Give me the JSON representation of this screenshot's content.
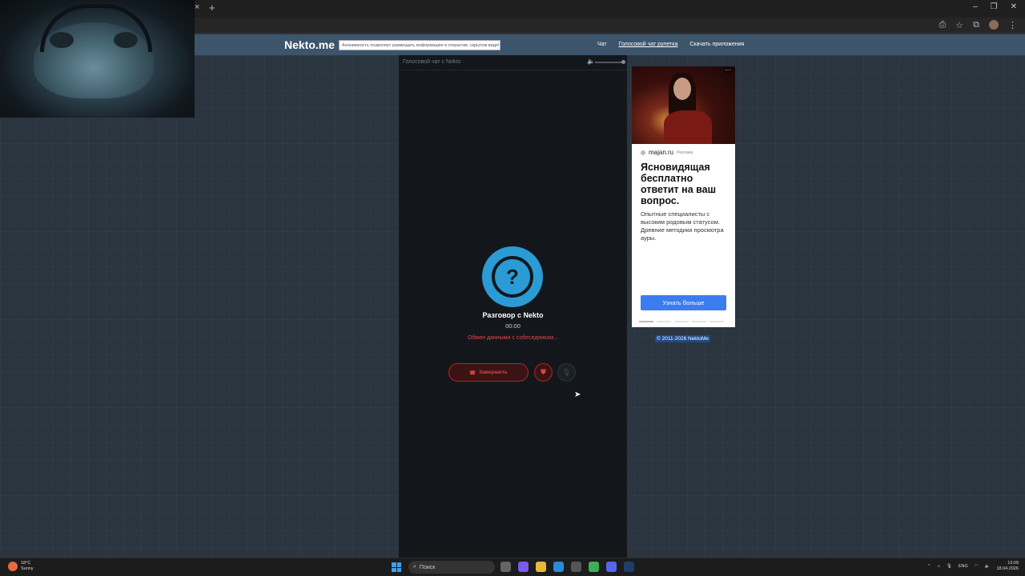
{
  "browser": {
    "tab_close": "×",
    "tab_new": "+",
    "window_controls": [
      "–",
      "❐",
      "✕"
    ],
    "toolbar_icons": [
      "install-icon",
      "star-icon",
      "extensions-icon",
      "profile-icon",
      "menu-icon"
    ]
  },
  "site": {
    "logo": "Nekto.me",
    "notice": "Анонимность позволяет размещать информацию в открытом, скрытом виде!",
    "nav": [
      {
        "label": "Чат",
        "active": false
      },
      {
        "label": "Голосовой чат рулетка",
        "active": true
      },
      {
        "label": "Скачать приложения",
        "active": false
      }
    ]
  },
  "chat": {
    "title": "Голосовой чат с Nekto",
    "conversation_title": "Разговор с Nekto",
    "timer": "00:00",
    "status": "Обмен данными с собеседником...",
    "end_button": "Завершить",
    "question_mark": "?"
  },
  "ad": {
    "domain": "majan.ru",
    "tag": "Реклама",
    "headline": "Ясновидящая бесплатно ответит на ваш вопрос.",
    "description": "Опытные специалисты с высоким родовым статусом. Древние методики просмотра ауры.",
    "button": "Узнать больше",
    "menu": "···"
  },
  "footer": {
    "copyright": "© 2011-2026 NektoMe"
  },
  "taskbar": {
    "weather_temp": "18°C",
    "weather_desc": "Sunny",
    "search_placeholder": "Поиск",
    "language": "ENG",
    "time": "13:09",
    "date": "18.04.2026"
  },
  "colors": {
    "page_bg": "#2b3540",
    "header_bg": "#3d556b",
    "panel_bg": "#13171b",
    "accent_blue": "#2b9bd6",
    "danger_red": "#e0484a",
    "ad_button": "#3b7cf0"
  }
}
